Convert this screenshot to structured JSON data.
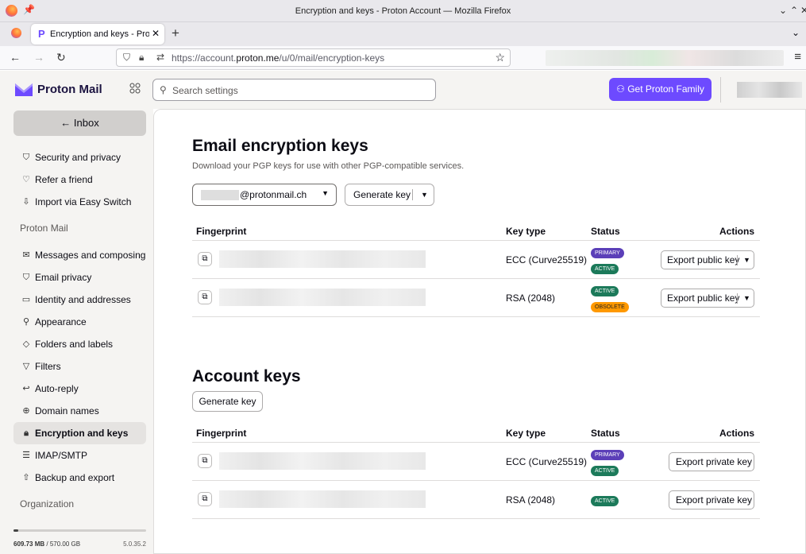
{
  "browser": {
    "window_title": "Encryption and keys - Proton Account — Mozilla Firefox",
    "tab_title": "Encryption and keys - Proton",
    "url_prefix": "https://account.",
    "url_host": "proton.me",
    "url_path": "/u/0/mail/encryption-keys",
    "icons": [
      "firefox-logo",
      "pin-icon",
      "close-icon",
      "plus-icon",
      "back-icon",
      "forward-icon",
      "reload-icon",
      "shield-icon",
      "lock-icon",
      "star-icon",
      "menu-icon"
    ]
  },
  "header": {
    "brand": "Proton Mail",
    "search_placeholder": "Search settings",
    "family_button": "Get Proton Family",
    "accent": "#6d4aff"
  },
  "sidebar": {
    "inbox": "← Inbox",
    "items_top": [
      {
        "label": "Security and privacy",
        "icon": "shield-icon"
      },
      {
        "label": "Refer a friend",
        "icon": "heart-icon"
      },
      {
        "label": "Import via Easy Switch",
        "icon": "import-icon"
      }
    ],
    "section_mail": "Proton Mail",
    "items_mail": [
      {
        "label": "Messages and composing",
        "icon": "envelope-icon"
      },
      {
        "label": "Email privacy",
        "icon": "shield-icon"
      },
      {
        "label": "Identity and addresses",
        "icon": "id-card-icon"
      },
      {
        "label": "Appearance",
        "icon": "paint-roller-icon"
      },
      {
        "label": "Folders and labels",
        "icon": "tag-icon"
      },
      {
        "label": "Filters",
        "icon": "filter-icon"
      },
      {
        "label": "Auto-reply",
        "icon": "reply-icon"
      },
      {
        "label": "Domain names",
        "icon": "globe-icon"
      },
      {
        "label": "Encryption and keys",
        "icon": "lock-icon",
        "active": true
      },
      {
        "label": "IMAP/SMTP",
        "icon": "server-icon"
      },
      {
        "label": "Backup and export",
        "icon": "export-icon"
      }
    ],
    "section_org": "Organization",
    "storage_used": "609.73 MB",
    "storage_total": "/ 570.00 GB",
    "storage_fraction": 0.001,
    "version": "5.0.35.2"
  },
  "email_keys": {
    "title": "Email encryption keys",
    "subtitle": "Download your PGP keys for use with other PGP-compatible services.",
    "address": "@protonmail.ch",
    "generate": "Generate key",
    "headers": {
      "fingerprint": "Fingerprint",
      "key_type": "Key type",
      "status": "Status",
      "actions": "Actions"
    },
    "rows": [
      {
        "key_type": "ECC (Curve25519)",
        "badges": [
          {
            "text": "PRIMARY",
            "kind": "primary"
          },
          {
            "text": "ACTIVE",
            "kind": "active"
          }
        ],
        "action": "Export public key"
      },
      {
        "key_type": "RSA (2048)",
        "badges": [
          {
            "text": "ACTIVE",
            "kind": "active"
          },
          {
            "text": "OBSOLETE",
            "kind": "obsolete"
          }
        ],
        "action": "Export public key"
      }
    ]
  },
  "account_keys": {
    "title": "Account keys",
    "generate": "Generate key",
    "headers": {
      "fingerprint": "Fingerprint",
      "key_type": "Key type",
      "status": "Status",
      "actions": "Actions"
    },
    "rows": [
      {
        "key_type": "ECC (Curve25519)",
        "badges": [
          {
            "text": "PRIMARY",
            "kind": "primary"
          },
          {
            "text": "ACTIVE",
            "kind": "active"
          }
        ],
        "action": "Export private key"
      },
      {
        "key_type": "RSA (2048)",
        "badges": [
          {
            "text": "ACTIVE",
            "kind": "active"
          }
        ],
        "action": "Export private key"
      }
    ]
  }
}
